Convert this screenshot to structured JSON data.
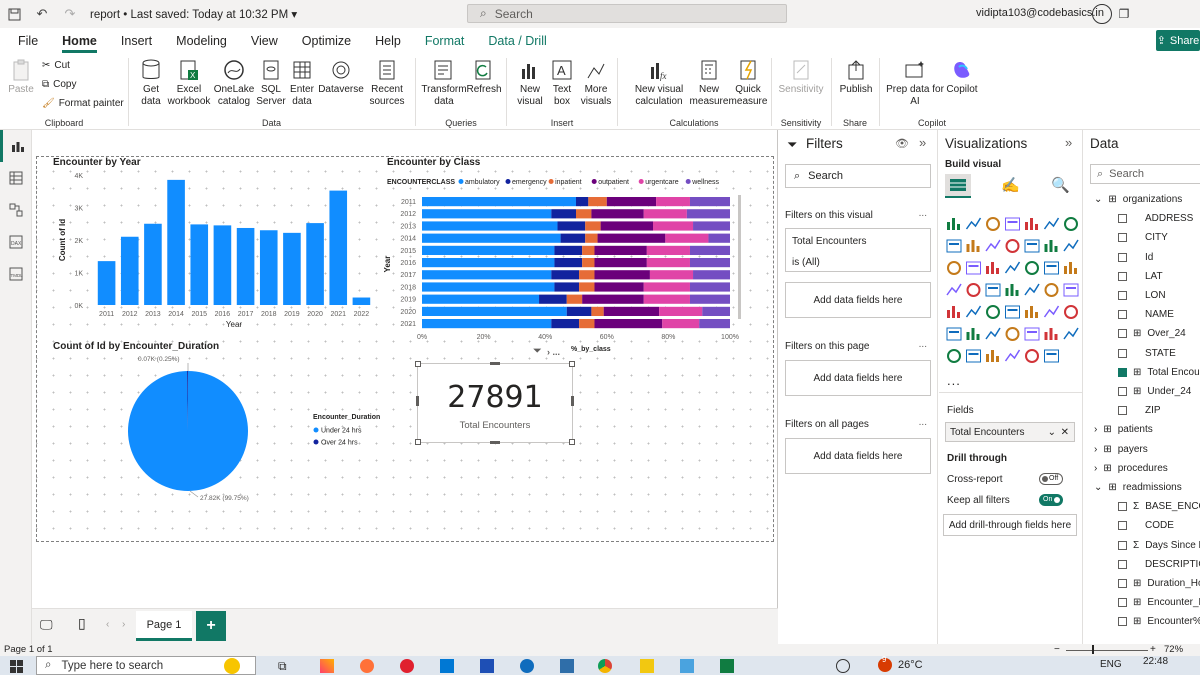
{
  "titlebar": {
    "title": "report",
    "saved": "Last saved: Today at 10:32 PM",
    "search_placeholder": "Search",
    "user": "vidipta103@codebasics.in"
  },
  "menu": [
    "File",
    "Home",
    "Insert",
    "Modeling",
    "View",
    "Optimize",
    "Help",
    "Format",
    "Data / Drill"
  ],
  "share_label": "Share",
  "ribbon": {
    "clipboard": {
      "paste": "Paste",
      "cut": "Cut",
      "copy": "Copy",
      "format_painter": "Format painter",
      "label": "Clipboard"
    },
    "data": {
      "get_data": "Get data",
      "excel": "Excel workbook",
      "onelake": "OneLake catalog",
      "sql": "SQL Server",
      "enter": "Enter data",
      "dataverse": "Dataverse",
      "recent": "Recent sources",
      "label": "Data"
    },
    "queries": {
      "transform": "Transform data",
      "refresh": "Refresh",
      "label": "Queries"
    },
    "insert": {
      "new_visual": "New visual",
      "text_box": "Text box",
      "more_visuals": "More visuals",
      "label": "Insert"
    },
    "calculations": {
      "new_calc": "New visual calculation",
      "new_measure": "New measure",
      "quick_measure": "Quick measure",
      "label": "Calculations"
    },
    "sensitivity": {
      "btn": "Sensitivity",
      "label": "Sensitivity"
    },
    "share": {
      "publish": "Publish",
      "label": "Share"
    },
    "copilot": {
      "prep": "Prep data for AI",
      "copilot": "Copilot",
      "label": "Copilot"
    }
  },
  "charts": {
    "year": {
      "title": "Encounter by Year",
      "xlabel": "Year",
      "ylabel": "Count of Id"
    },
    "class": {
      "title": "Encounter by Class",
      "legend_title": "ENCOUNTERCLASS",
      "ylabel": "Year",
      "xlabel": "%_by_class"
    },
    "duration": {
      "title": "Count of Id by Encounter_Duration",
      "legend_title": "Encounter_Duration",
      "label_small": "0.07K (0.25%)",
      "label_big": "27.82K (99.75%)"
    },
    "card": {
      "value": "27891",
      "label": "Total Encounters"
    }
  },
  "chart_data": [
    {
      "type": "bar",
      "title": "Encounter by Year",
      "xlabel": "Year",
      "ylabel": "Count of Id",
      "categories": [
        "2011",
        "2012",
        "2013",
        "2014",
        "2015",
        "2016",
        "2017",
        "2018",
        "2019",
        "2020",
        "2021",
        "2022"
      ],
      "values": [
        1350,
        2100,
        2500,
        3850,
        2480,
        2450,
        2370,
        2300,
        2220,
        2520,
        3520,
        230
      ],
      "ylim": [
        0,
        4000
      ],
      "yticks": [
        "0K",
        "1K",
        "2K",
        "3K",
        "4K"
      ],
      "color": "#118dff",
      "grid": false
    },
    {
      "type": "bar",
      "title": "Encounter by Class",
      "orientation": "horizontal-stacked-100",
      "xlabel": "%_by_class",
      "ylabel": "Year",
      "categories": [
        "2011",
        "2012",
        "2013",
        "2014",
        "2015",
        "2016",
        "2017",
        "2018",
        "2019",
        "2020",
        "2021"
      ],
      "xticks": [
        "0%",
        "20%",
        "40%",
        "60%",
        "80%",
        "100%"
      ],
      "series": [
        {
          "name": "ambulatory",
          "color": "#118dff",
          "values": [
            50,
            42,
            44,
            45,
            43,
            43,
            42,
            43,
            38,
            47,
            42
          ]
        },
        {
          "name": "emergency",
          "color": "#12239e",
          "values": [
            4,
            8,
            9,
            8,
            9,
            9,
            9,
            8,
            9,
            8,
            9
          ]
        },
        {
          "name": "inpatient",
          "color": "#e66c37",
          "values": [
            6,
            5,
            5,
            4,
            4,
            4,
            5,
            5,
            5,
            4,
            5
          ]
        },
        {
          "name": "outpatient",
          "color": "#6b007b",
          "values": [
            16,
            17,
            17,
            22,
            17,
            17,
            18,
            16,
            20,
            18,
            22
          ]
        },
        {
          "name": "urgentcare",
          "color": "#e044a7",
          "values": [
            11,
            14,
            13,
            14,
            14,
            14,
            14,
            15,
            15,
            14,
            12
          ]
        },
        {
          "name": "wellness",
          "color": "#744ec2",
          "values": [
            13,
            14,
            12,
            7,
            13,
            13,
            12,
            13,
            13,
            9,
            10
          ]
        }
      ]
    },
    {
      "type": "pie",
      "title": "Count of Id by Encounter_Duration",
      "series": [
        {
          "name": "Under 24 hrs",
          "value": 27820,
          "color": "#118dff"
        },
        {
          "name": "Over 24 hrs",
          "value": 70,
          "color": "#12239e"
        }
      ]
    }
  ],
  "filters": {
    "title": "Filters",
    "search": "Search",
    "on_visual": "Filters on this visual",
    "card_title": "Total Encounters",
    "card_state": "is (All)",
    "add": "Add data fields here",
    "on_page": "Filters on this page",
    "on_all": "Filters on all pages"
  },
  "viz": {
    "title": "Visualizations",
    "build": "Build visual",
    "fields": "Fields",
    "field_value": "Total Encounters",
    "drill": "Drill through",
    "cross": "Cross-report",
    "cross_state": "Off",
    "keep": "Keep all filters",
    "keep_state": "On",
    "add_drill": "Add drill-through fields here"
  },
  "data_panel": {
    "title": "Data",
    "search": "Search",
    "tables": [
      {
        "name": "organizations",
        "expanded": true,
        "fields": [
          {
            "name": "ADDRESS",
            "checked": false,
            "kind": "field"
          },
          {
            "name": "CITY",
            "checked": false,
            "kind": "field"
          },
          {
            "name": "Id",
            "checked": false,
            "kind": "field"
          },
          {
            "name": "LAT",
            "checked": false,
            "kind": "field"
          },
          {
            "name": "LON",
            "checked": false,
            "kind": "field"
          },
          {
            "name": "NAME",
            "checked": false,
            "kind": "field"
          },
          {
            "name": "Over_24",
            "checked": false,
            "kind": "calc"
          },
          {
            "name": "STATE",
            "checked": false,
            "kind": "field"
          },
          {
            "name": "Total Encou",
            "checked": true,
            "kind": "calc"
          },
          {
            "name": "Under_24",
            "checked": false,
            "kind": "calc"
          },
          {
            "name": "ZIP",
            "checked": false,
            "kind": "field"
          }
        ]
      },
      {
        "name": "patients",
        "expanded": false
      },
      {
        "name": "payers",
        "expanded": false
      },
      {
        "name": "procedures",
        "expanded": false
      },
      {
        "name": "readmissions",
        "expanded": true,
        "fields": [
          {
            "name": "BASE_ENCO",
            "checked": false,
            "kind": "sum"
          },
          {
            "name": "CODE",
            "checked": false,
            "kind": "field"
          },
          {
            "name": "Days Since L",
            "checked": false,
            "kind": "sum"
          },
          {
            "name": "DESCRIPTIO",
            "checked": false,
            "kind": "field"
          },
          {
            "name": "Duration_Ho",
            "checked": false,
            "kind": "calc"
          },
          {
            "name": "Encounter_D",
            "checked": false,
            "kind": "calc"
          },
          {
            "name": "Encounter%",
            "checked": false,
            "kind": "calc"
          }
        ]
      }
    ]
  },
  "pagebar": {
    "page": "Page 1"
  },
  "status": {
    "page_of": "Page 1 of 1",
    "zoom": "72%"
  },
  "taskbar": {
    "search": "Type here to search",
    "temp": "26°C",
    "lang": "ENG",
    "time": "22:48",
    "badge": "9"
  }
}
